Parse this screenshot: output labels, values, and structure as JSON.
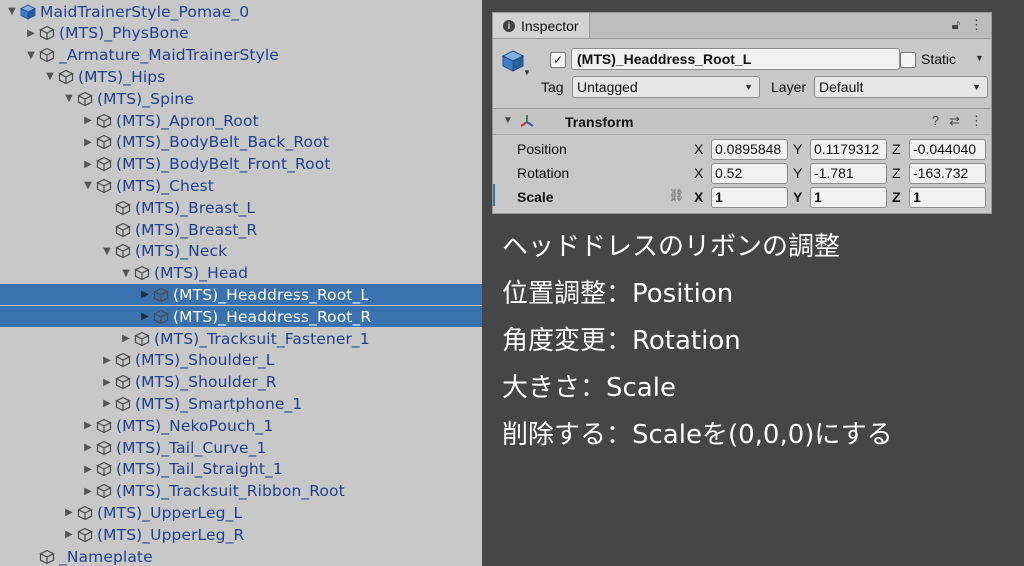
{
  "hierarchy": {
    "items": [
      {
        "label": "MaidTrainerStyle_Pomae_0",
        "depth": 0,
        "expanded": true,
        "root": true
      },
      {
        "label": "(MTS)_PhysBone",
        "depth": 1,
        "expanded": false
      },
      {
        "label": "_Armature_MaidTrainerStyle",
        "depth": 1,
        "expanded": true
      },
      {
        "label": "(MTS)_Hips",
        "depth": 2,
        "expanded": true
      },
      {
        "label": "(MTS)_Spine",
        "depth": 3,
        "expanded": true
      },
      {
        "label": "(MTS)_Apron_Root",
        "depth": 4,
        "expanded": false
      },
      {
        "label": "(MTS)_BodyBelt_Back_Root",
        "depth": 4,
        "expanded": false
      },
      {
        "label": "(MTS)_BodyBelt_Front_Root",
        "depth": 4,
        "expanded": false
      },
      {
        "label": "(MTS)_Chest",
        "depth": 4,
        "expanded": true
      },
      {
        "label": "(MTS)_Breast_L",
        "depth": 5,
        "expanded": null
      },
      {
        "label": "(MTS)_Breast_R",
        "depth": 5,
        "expanded": null
      },
      {
        "label": "(MTS)_Neck",
        "depth": 5,
        "expanded": true
      },
      {
        "label": "(MTS)_Head",
        "depth": 6,
        "expanded": true
      },
      {
        "label": "(MTS)_Headdress_Root_L",
        "depth": 7,
        "expanded": false,
        "selected": true
      },
      {
        "label": "(MTS)_Headdress_Root_R",
        "depth": 7,
        "expanded": false,
        "selected": true
      },
      {
        "label": "(MTS)_Tracksuit_Fastener_1",
        "depth": 6,
        "expanded": false
      },
      {
        "label": "(MTS)_Shoulder_L",
        "depth": 5,
        "expanded": false
      },
      {
        "label": "(MTS)_Shoulder_R",
        "depth": 5,
        "expanded": false
      },
      {
        "label": "(MTS)_Smartphone_1",
        "depth": 5,
        "expanded": false
      },
      {
        "label": "(MTS)_NekoPouch_1",
        "depth": 4,
        "expanded": false
      },
      {
        "label": "(MTS)_Tail_Curve_1",
        "depth": 4,
        "expanded": false
      },
      {
        "label": "(MTS)_Tail_Straight_1",
        "depth": 4,
        "expanded": false
      },
      {
        "label": "(MTS)_Tracksuit_Ribbon_Root",
        "depth": 4,
        "expanded": false
      },
      {
        "label": "(MTS)_UpperLeg_L",
        "depth": 3,
        "expanded": false
      },
      {
        "label": "(MTS)_UpperLeg_R",
        "depth": 3,
        "expanded": false
      },
      {
        "label": "_Nameplate",
        "depth": 1,
        "expanded": null
      }
    ]
  },
  "inspector": {
    "tab_title": "Inspector",
    "object_name": "(MTS)_Headdress_Root_L",
    "active_checked": "✓",
    "static_label": "Static",
    "tag_label": "Tag",
    "tag_value": "Untagged",
    "layer_label": "Layer",
    "layer_value": "Default",
    "component_title": "Transform",
    "axis_x": "X",
    "axis_y": "Y",
    "axis_z": "Z",
    "position": {
      "label": "Position",
      "x": "0.0895848",
      "y": "0.1179312",
      "z": "-0.044040"
    },
    "rotation": {
      "label": "Rotation",
      "x": "0.52",
      "y": "-1.781",
      "z": "-163.732"
    },
    "scale": {
      "label": "Scale",
      "x": "1",
      "y": "1",
      "z": "1"
    }
  },
  "notes": [
    "ヘッドドレスのリボンの調整",
    "位置調整：Position",
    "角度変更：Rotation",
    "大きさ：Scale",
    "削除する：Scaleを(0,0,0)にする"
  ],
  "colors": {
    "selection": "#3a72b0",
    "hierarchy_bg": "#c8c8c8",
    "dark_bg": "#464646",
    "label_blue": "#1f3f8f"
  }
}
